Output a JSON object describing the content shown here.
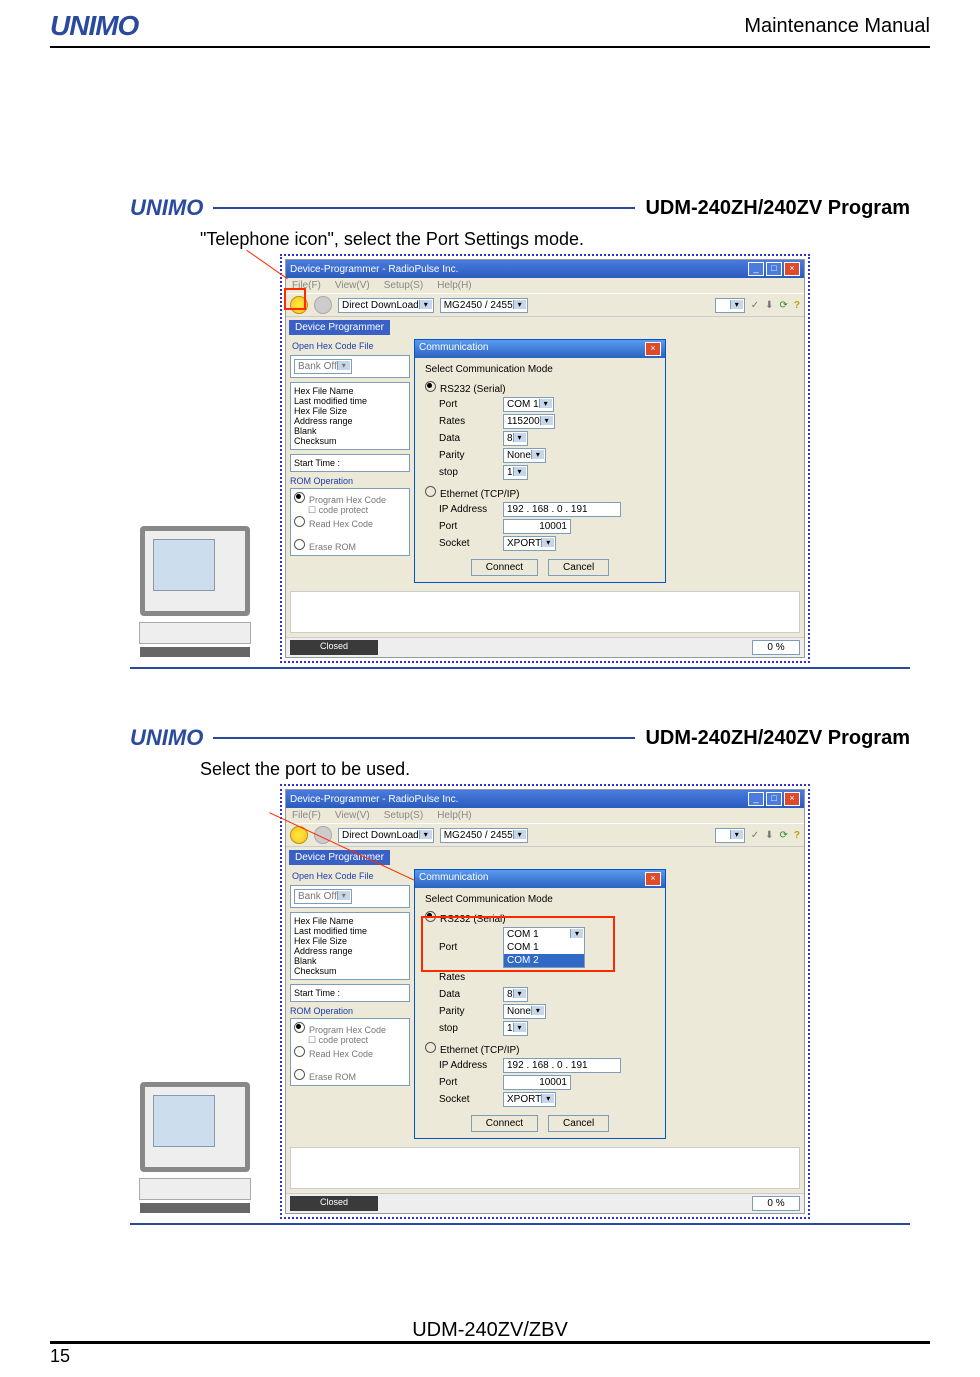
{
  "header": {
    "logo": "UNIMO",
    "title": "Maintenance Manual"
  },
  "footer": {
    "model": "UDM-240ZV/ZBV",
    "page": "15"
  },
  "panels": [
    {
      "logo": "UNIMO",
      "title": "UDM-240ZH/240ZV Program",
      "callout": "\"Telephone icon\", select the Port Settings mode."
    },
    {
      "logo": "UNIMO",
      "title": "UDM-240ZH/240ZV Program",
      "callout": "Select the port to be used."
    }
  ],
  "win": {
    "title": "Device-Programmer - RadioPulse Inc.",
    "menus": [
      "File(F)",
      "View(V)",
      "Setup(S)",
      "Help(H)"
    ],
    "toolbar": {
      "mode": "Direct DownLoad",
      "chip": "MG2450 / 2455"
    },
    "tab": "Device Programmer",
    "openHex": "Open Hex Code File",
    "bankOff": "Bank Off",
    "infoLabels": [
      "Hex File Name",
      "Last modified time",
      "Hex File Size",
      "Address range",
      "Blank",
      "Checksum"
    ],
    "startTime": "Start Time  :",
    "romOp": "ROM Operation",
    "romItems": [
      "Program Hex Code",
      "code protect",
      "Read Hex Code",
      "Erase ROM"
    ],
    "status": {
      "state": "Closed",
      "pct": "0 %"
    }
  },
  "comm": {
    "title": "Communication",
    "heading": "Select Communication Mode",
    "serialLabel": "RS232 (Serial)",
    "fields": {
      "port": "Port",
      "rates": "Rates",
      "data": "Data",
      "parity": "Parity",
      "stop": "stop"
    },
    "values": {
      "port": "COM 1",
      "rates": "115200",
      "data": "8",
      "parity": "None",
      "stop": "1"
    },
    "portOptions": [
      "COM 1",
      "COM 2"
    ],
    "ethLabel": "Ethernet (TCP/IP)",
    "eth": {
      "ipLabel": "IP Address",
      "ip": "192 . 168 .  0  . 191",
      "portLabel": "Port",
      "port": "10001",
      "sockLabel": "Socket",
      "sock": "XPORT"
    },
    "btns": {
      "connect": "Connect",
      "cancel": "Cancel"
    }
  }
}
